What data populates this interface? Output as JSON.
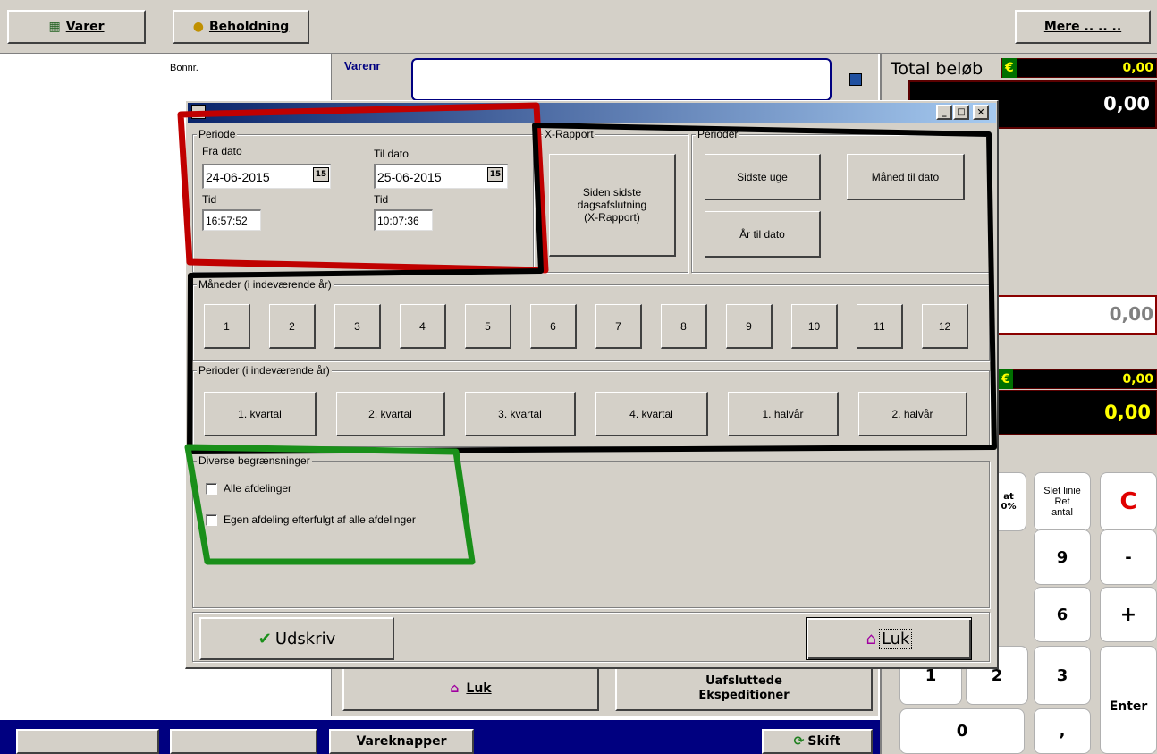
{
  "topbar": {
    "varer_label": "Varer",
    "beholdning_label": "Beholdning",
    "mere_label": "Mere .. .. .."
  },
  "main": {
    "bonnr_label": "Bonnr.",
    "varenr_label": "Varenr",
    "varenr_value": ""
  },
  "right_panel": {
    "total_label": "Total beløb",
    "euro_symbol": "€",
    "total_euro_value": "0,00",
    "total_value": "0,00",
    "field_value": "0,00",
    "euro2_value": "0,00",
    "value2": "0,00"
  },
  "keypad": {
    "moms_label_line1": "at",
    "moms_label_line2": "0%",
    "slet_linie": "Slet linie",
    "ret": "Ret",
    "antal": "antal",
    "c": "C",
    "k9": "9",
    "minus": "-",
    "k6": "6",
    "plus": "+",
    "k1": "1",
    "k2": "2",
    "k3": "3",
    "enter": "Enter",
    "k0": "0",
    "comma": ","
  },
  "behind_buttons": {
    "luk_label": "Luk",
    "uafsluttede_line1": "Uafsluttede",
    "uafsluttede_line2": "Ekspeditioner",
    "vareknapper_label": "Vareknapper",
    "skift_label": "Skift"
  },
  "dialog": {
    "title_partial": "",
    "periode_group": "Periode",
    "fra_dato_label": "Fra dato",
    "fra_dato_value": "24-06-2015",
    "til_dato_label": "Til dato",
    "til_dato_value": "25-06-2015",
    "tid_label": "Tid",
    "fra_tid_value": "16:57:52",
    "til_tid_value": "10:07:36",
    "cal_icon_text": "15",
    "xrapport_group": "X-Rapport",
    "xrapport_btn_line1": "Siden sidste",
    "xrapport_btn_line2": "dagsafslutning",
    "xrapport_btn_line3": "(X-Rapport)",
    "perioder_group": "Perioder",
    "sidste_uge": "Sidste uge",
    "maaned_til_dato": "Måned til dato",
    "aar_til_dato": "År til dato",
    "maaneder_group": "Måneder (i indeværende år)",
    "months": [
      "1",
      "2",
      "3",
      "4",
      "5",
      "6",
      "7",
      "8",
      "9",
      "10",
      "11",
      "12"
    ],
    "perioder2_group": "Perioder (i indeværende år)",
    "periods": [
      "1. kvartal",
      "2. kvartal",
      "3. kvartal",
      "4. kvartal",
      "1. halvår",
      "2. halvår"
    ],
    "diverse_group": "Diverse begrænsninger",
    "chk_alle": "Alle afdelinger",
    "chk_egen": "Egen afdeling efterfulgt af alle afdelinger",
    "udskriv_label": "Udskriv",
    "luk_label": "Luk"
  },
  "colors": {
    "window_bg": "#d4d0c8",
    "title_bar": "#0a246a",
    "annot_red": "#c00000",
    "annot_black": "#000000",
    "annot_green": "#1a8f1a",
    "blue_panel": "#000080"
  }
}
